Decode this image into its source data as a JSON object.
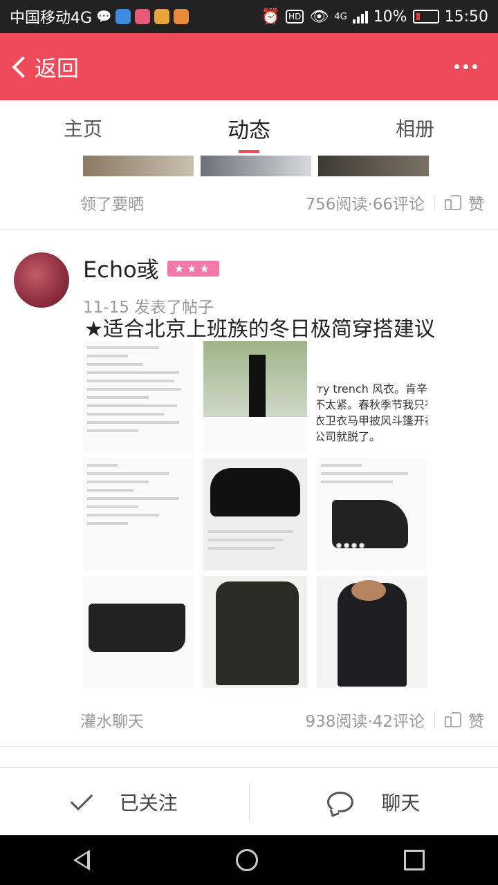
{
  "status_bar": {
    "carrier": "中国移动4G",
    "battery": "10%",
    "time": "15:50",
    "network": "4G",
    "hd": "HD"
  },
  "topbar": {
    "back_label": "返回",
    "background": "#ef4a5a"
  },
  "tabs": [
    {
      "label": "主页"
    },
    {
      "label": "动态"
    },
    {
      "label": "相册"
    }
  ],
  "active_tab": "动态",
  "feed": {
    "post_prev": {
      "category": "领了要晒",
      "stats": "756阅读·66评论",
      "like_label": "赞"
    },
    "post": {
      "author": "Echo彧",
      "badge": "★★★",
      "time_text": "11-15  发表了帖子",
      "title": "★适合北京上班族的冬日极简穿搭建议",
      "image_text_3": [
        "rry trench 风衣。肯辛顿",
        "不太紧。春秋季节我只有",
        "衣卫衣马甲披风斗篷开衫",
        "公司就脱了。"
      ],
      "category": "灌水聊天",
      "stats": "938阅读·42评论",
      "like_label": "赞"
    }
  },
  "actions": {
    "follow_label": "已关注",
    "chat_label": "聊天"
  }
}
